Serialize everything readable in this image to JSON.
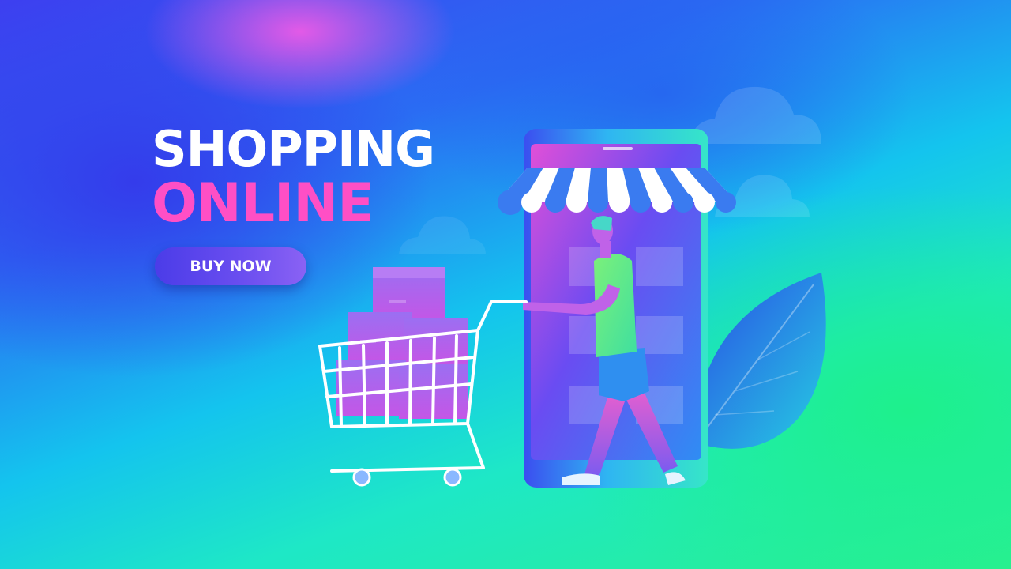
{
  "banner": {
    "headline_line1": "SHOPPING",
    "headline_line2": "ONLINE",
    "cta_label": "BUY NOW"
  },
  "colors": {
    "headline_white": "#ffffff",
    "headline_pink": "#ff4fc5",
    "cta_purple": "#5a45ec",
    "background_blue": "#3d3ff0",
    "background_green": "#2af08f"
  },
  "illustration": {
    "elements": [
      "clouds",
      "smartphone-storefront",
      "striped-awning",
      "shopper-figure",
      "shopping-cart",
      "parcel-boxes",
      "leaf"
    ]
  }
}
